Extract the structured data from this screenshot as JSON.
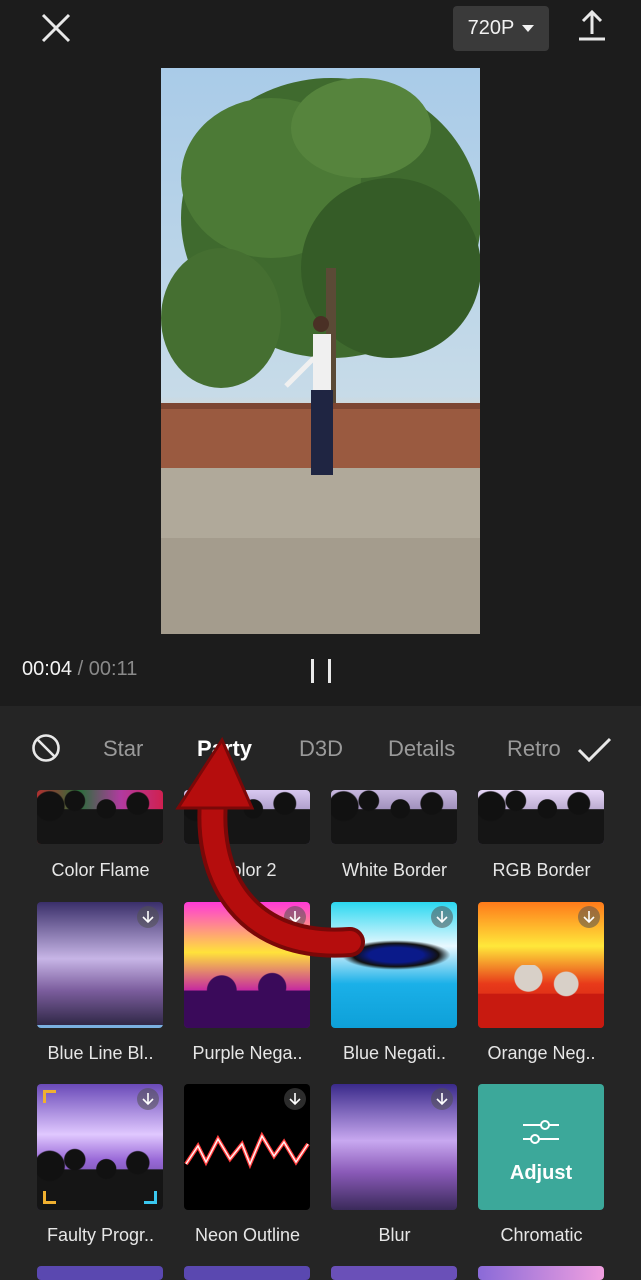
{
  "header": {
    "resolution": "720P",
    "close_icon": "close-icon",
    "export_icon": "upload-icon"
  },
  "player": {
    "current_time": "00:04",
    "separator": "/",
    "total_time": "00:11",
    "state_icon": "pause-icon"
  },
  "effects_panel": {
    "tabs": [
      {
        "label": "Star",
        "active": false
      },
      {
        "label": "Party",
        "active": true
      },
      {
        "label": "D3D",
        "active": false
      },
      {
        "label": "Details",
        "active": false
      },
      {
        "label": "Retro",
        "active": false
      }
    ],
    "rows": [
      [
        {
          "label": "Color Flame"
        },
        {
          "label": "Color 2"
        },
        {
          "label": "White Border"
        },
        {
          "label": "RGB Border"
        }
      ],
      [
        {
          "label": "Blue Line Bl.."
        },
        {
          "label": "Purple Nega.."
        },
        {
          "label": "Blue Negati.."
        },
        {
          "label": "Orange Neg.."
        }
      ],
      [
        {
          "label": "Faulty Progr.."
        },
        {
          "label": "Neon Outline"
        },
        {
          "label": "Blur"
        },
        {
          "label": "Chromatic",
          "overlay": "Adjust"
        }
      ]
    ]
  },
  "colors": {
    "background": "#1c1c1c",
    "panel": "#252525",
    "annotation_arrow": "#b50d0d"
  }
}
